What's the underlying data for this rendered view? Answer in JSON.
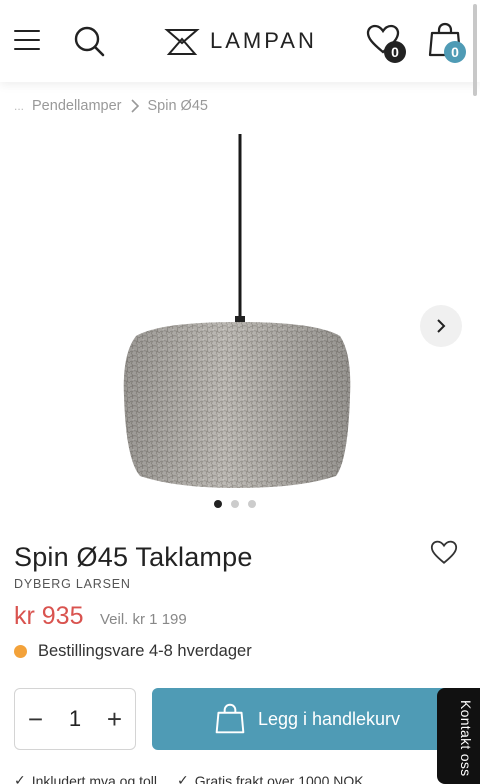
{
  "header": {
    "logo_text": "LAMPAN",
    "wishlist_count": "0",
    "cart_count": "0",
    "icons": [
      "menu-icon",
      "search-icon",
      "heart-icon",
      "bag-icon"
    ]
  },
  "breadcrumb": {
    "ellipsis": "...",
    "items": [
      "Pendellamper",
      "Spin Ø45"
    ]
  },
  "gallery": {
    "dots_total": 3,
    "active_index": 0
  },
  "product": {
    "title": "Spin Ø45 Taklampe",
    "brand": "DYBERG LARSEN",
    "price": "kr 935",
    "original_price": "Veil. kr 1 199",
    "stock_text": "Bestillingsvare 4-8 hverdager",
    "stock_color": "#f3a23a"
  },
  "purchase": {
    "quantity": "1",
    "minus": "−",
    "plus": "+",
    "add_to_cart": "Legg i handlekurv"
  },
  "contact_tab": "Kontakt oss",
  "usps": [
    "Inkludert mva og toll",
    "Gratis frakt over 1000 NOK"
  ],
  "colors": {
    "accent": "#4f9bb5",
    "price": "#d9534f"
  }
}
